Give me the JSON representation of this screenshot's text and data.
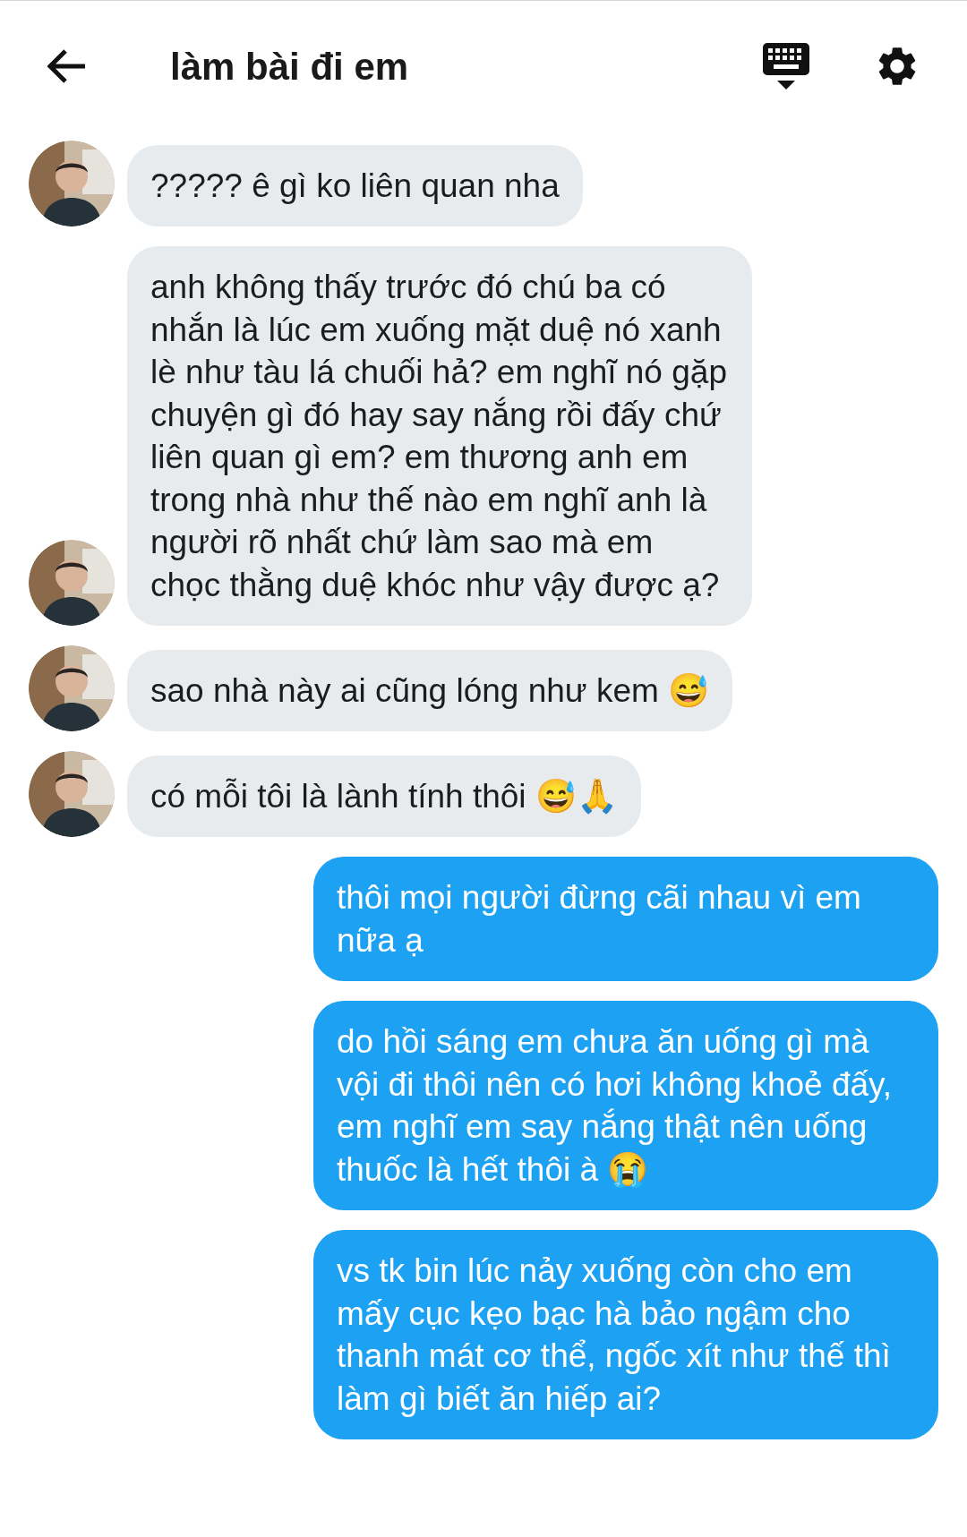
{
  "header": {
    "title": "làm bài đi em"
  },
  "messages": [
    {
      "kind": "received",
      "text": "????? ê gì ko liên quan nha"
    },
    {
      "kind": "received",
      "text": "anh không thấy trước đó chú ba có nhắn là lúc em xuống mặt duệ nó xanh lè như tàu lá chuối hả? em nghĩ nó gặp chuyện gì đó hay say nắng rồi đấy chứ liên quan gì em? em thương anh em trong nhà như thế nào em nghĩ anh là người rõ nhất chứ làm sao mà em chọc thằng duệ khóc như vậy được ạ?"
    },
    {
      "kind": "received",
      "text": "sao nhà này ai cũng lóng như kem 😅"
    },
    {
      "kind": "received",
      "text": "có mỗi tôi là lành tính thôi 😅🙏"
    },
    {
      "kind": "sent",
      "text": "thôi mọi người đừng cãi nhau vì em nữa ạ"
    },
    {
      "kind": "sent",
      "text": "do hồi sáng em chưa ăn uống gì mà vội đi thôi nên có hơi không khoẻ đấy, em nghĩ em say nắng thật nên uống thuốc là hết thôi à 😭"
    },
    {
      "kind": "sent",
      "text": "vs tk bin lúc nảy xuống còn cho em mấy cục kẹo bạc hà bảo ngậm cho thanh mát cơ thể, ngốc xít như thế thì làm gì biết ăn hiếp ai?"
    }
  ]
}
